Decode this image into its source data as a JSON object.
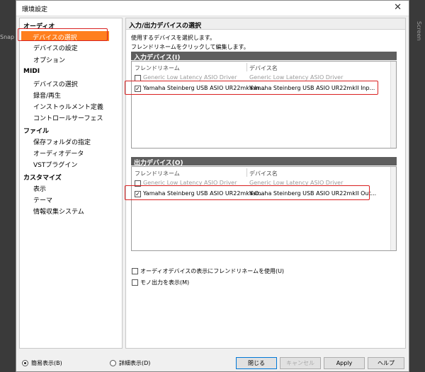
{
  "app": {
    "left_strip_label": "Snap",
    "right_strip_label": "Screen"
  },
  "window": {
    "title": "環境設定",
    "close_glyph": "✕"
  },
  "sidebar": {
    "audio": {
      "label": "オーディオ",
      "items": [
        "デバイスの選択",
        "デバイスの設定",
        "オプション"
      ]
    },
    "midi": {
      "label": "MIDI",
      "items": [
        "デバイスの選択",
        "録音/再生",
        "インストゥルメント定義",
        "コントロールサーフェス"
      ]
    },
    "file": {
      "label": "ファイル",
      "items": [
        "保存フォルダの指定",
        "オーディオデータ",
        "VSTプラグイン"
      ]
    },
    "customize": {
      "label": "カスタマイズ",
      "items": [
        "表示",
        "テーマ",
        "情報収集システム"
      ]
    }
  },
  "main": {
    "header": "入力/出力デバイスの選択",
    "desc1": "使用するデバイスを選択します。",
    "desc2": "フレンドリネームをクリックして編集します。",
    "columns": {
      "friendly": "フレンドリネーム",
      "device": "デバイス名"
    },
    "input": {
      "title": "入力デバイス(I)",
      "rows": [
        {
          "friendly": "Generic Low Latency ASIO Driver",
          "device": "Generic Low Latency ASIO Driver",
          "checked": false
        },
        {
          "friendly": "Yamaha Steinberg USB ASIO UR22mkII In...",
          "device": "Yamaha Steinberg USB ASIO UR22mkII Inp...",
          "checked": true
        }
      ]
    },
    "output": {
      "title": "出力デバイス(O)",
      "rows": [
        {
          "friendly": "Generic Low Latency ASIO Driver",
          "device": "Generic Low Latency ASIO Driver",
          "checked": false
        },
        {
          "friendly": "Yamaha Steinberg USB ASIO UR22mkII O...",
          "device": "Yamaha Steinberg USB ASIO UR22mkII Out...",
          "checked": true
        }
      ]
    },
    "options": {
      "use_friendly": "オーディオデバイスの表示にフレンドリネームを使用(U)",
      "mono": "モノ出力を表示(M)"
    }
  },
  "bottom": {
    "simple_view": "簡易表示(B)",
    "detail_view": "詳細表示(D)",
    "close": "閉じる",
    "cancel": "キャンセル",
    "apply": "Apply",
    "help": "ヘルプ"
  },
  "colors": {
    "selection": "#ff7f1e",
    "highlight": "#d92020",
    "group_header": "#5e5e5e"
  }
}
